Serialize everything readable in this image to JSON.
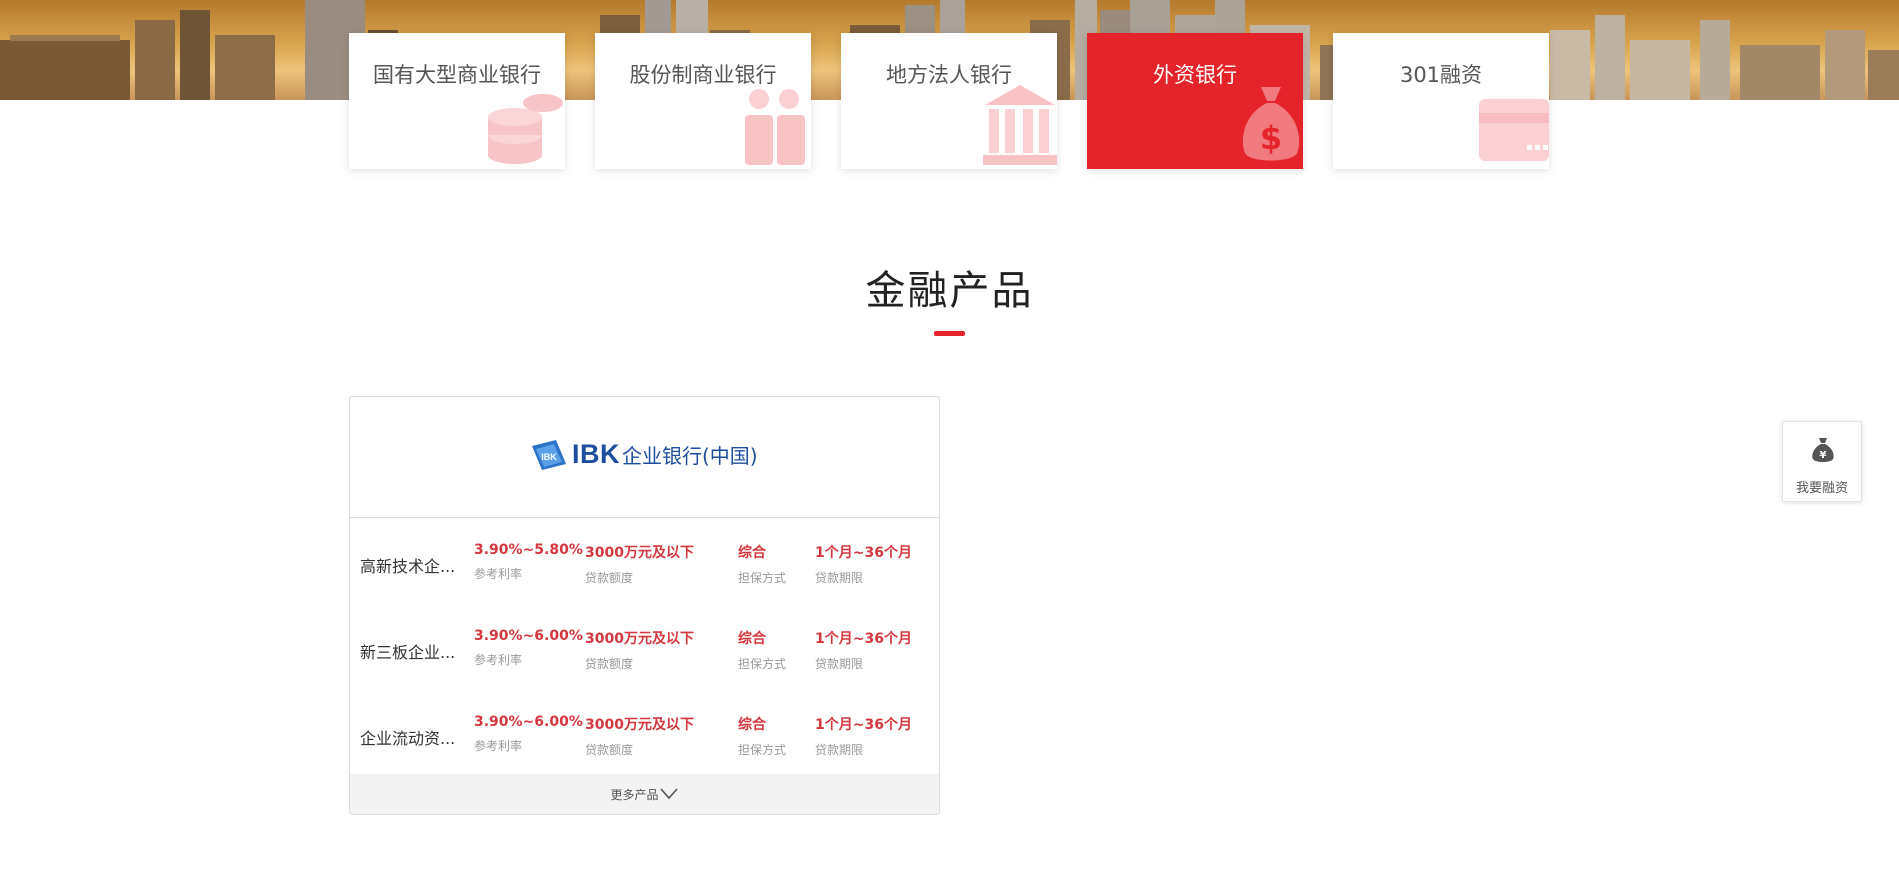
{
  "categories": [
    {
      "label": "国有大型商业银行",
      "icon": "coins-icon",
      "active": false
    },
    {
      "label": "股份制商业银行",
      "icon": "people-icon",
      "active": false
    },
    {
      "label": "地方法人银行",
      "icon": "bank-building-icon",
      "active": false
    },
    {
      "label": "外资银行",
      "icon": "money-bag-icon",
      "active": true
    },
    {
      "label": "301融资",
      "icon": "card-icon",
      "active": false
    }
  ],
  "section": {
    "title": "金融产品"
  },
  "bank": {
    "logo_text": "IBK",
    "logo_cn": "企业银行(中国)"
  },
  "labels": {
    "rate": "参考利率",
    "amount": "贷款额度",
    "guarantee": "担保方式",
    "term": "贷款期限"
  },
  "products": [
    {
      "name": "高新技术企...",
      "rate": "3.90%~5.80%",
      "amount": "3000万元及以下",
      "guarantee": "综合",
      "term": "1个月~36个月"
    },
    {
      "name": "新三板企业...",
      "rate": "3.90%~6.00%",
      "amount": "3000万元及以下",
      "guarantee": "综合",
      "term": "1个月~36个月"
    },
    {
      "name": "企业流动资...",
      "rate": "3.90%~6.00%",
      "amount": "3000万元及以下",
      "guarantee": "综合",
      "term": "1个月~36个月"
    }
  ],
  "more": {
    "label": "更多产品"
  },
  "float_button": {
    "label": "我要融资",
    "icon": "money-bag-icon"
  },
  "colors": {
    "accent": "#e5232a",
    "value_red": "#d4373e",
    "brand_blue": "#1d4f9e"
  }
}
